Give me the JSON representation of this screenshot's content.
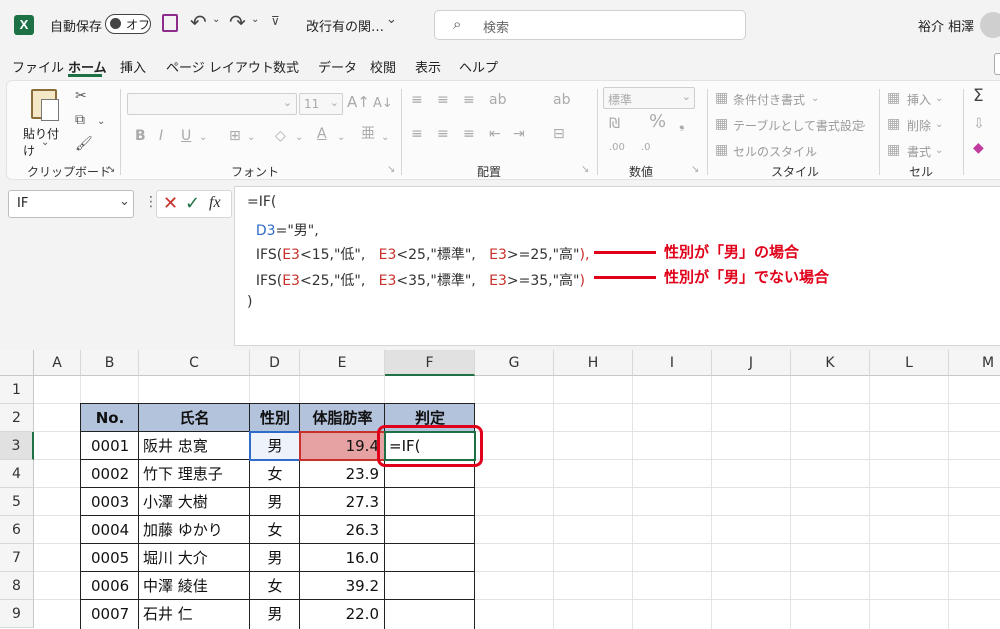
{
  "titlebar": {
    "autosave_label": "自動保存",
    "toggle_label": "オフ",
    "filename": "改行有の関…",
    "search_placeholder": "検索",
    "user_name": "裕介 相澤"
  },
  "menu": [
    "ファイル",
    "ホーム",
    "挿入",
    "ページ レイアウト",
    "数式",
    "データ",
    "校閲",
    "表示",
    "ヘルプ"
  ],
  "active_menu": "ホーム",
  "ribbon": {
    "clipboard": {
      "paste": "貼り付け",
      "label": "クリップボード"
    },
    "font": {
      "size": "11",
      "label": "フォント"
    },
    "alignment": {
      "label": "配置"
    },
    "number": {
      "format": "標準",
      "label": "数値"
    },
    "styles": {
      "conditional": "条件付き書式",
      "table": "テーブルとして書式設定",
      "cell_style": "セルのスタイル",
      "label": "スタイル"
    },
    "cells": {
      "insert": "挿入",
      "delete": "削除",
      "format": "書式",
      "label": "セル"
    }
  },
  "formula_bar": {
    "name_box": "IF",
    "fx": "fx",
    "lines": {
      "l1": "=IF(",
      "l2a": "D3",
      "l2b": "=\"男\",",
      "l3a": "IFS(",
      "l3b": "E3",
      "l3c": "<15,\"低\",",
      "l3d": "E3",
      "l3e": "<25,\"標準\",",
      "l3f": "E3",
      "l3g": ">=25,\"高\"",
      "l3h": "),",
      "l4a": "IFS(",
      "l4b": "E3",
      "l4c": "<25,\"低\",",
      "l4d": "E3",
      "l4e": "<35,\"標準\",",
      "l4f": "E3",
      "l4g": ">=35,\"高\"",
      "l4h": ")",
      "l5": ")"
    },
    "notes": [
      "性別が「男」の場合",
      "性別が「男」でない場合"
    ]
  },
  "grid": {
    "columns": [
      "A",
      "B",
      "C",
      "D",
      "E",
      "F",
      "G",
      "H",
      "I",
      "J",
      "K",
      "L",
      "M"
    ],
    "rows": [
      "1",
      "2",
      "3",
      "4",
      "5",
      "6",
      "7",
      "8",
      "9"
    ],
    "table_headers": [
      "No.",
      "氏名",
      "性別",
      "体脂肪率",
      "判定"
    ],
    "table_rows": [
      [
        "0001",
        "阪井 忠寛",
        "男",
        "19.4",
        "=IF("
      ],
      [
        "0002",
        "竹下 理恵子",
        "女",
        "23.9",
        ""
      ],
      [
        "0003",
        "小澤 大樹",
        "男",
        "27.3",
        ""
      ],
      [
        "0004",
        "加藤 ゆかり",
        "女",
        "26.3",
        ""
      ],
      [
        "0005",
        "堀川 大介",
        "男",
        "16.0",
        ""
      ],
      [
        "0006",
        "中澤 綾佳",
        "女",
        "39.2",
        ""
      ],
      [
        "0007",
        "石井 仁",
        "男",
        "22.0",
        ""
      ]
    ]
  },
  "colors": {
    "excel_green": "#1e7145",
    "header_fill": "#b4c3dc",
    "ref_blue": "#2e6cc8",
    "ref_red": "#c8312b",
    "highlight_red_fill": "#e6a2a2",
    "annotation_red": "#e0001a"
  }
}
